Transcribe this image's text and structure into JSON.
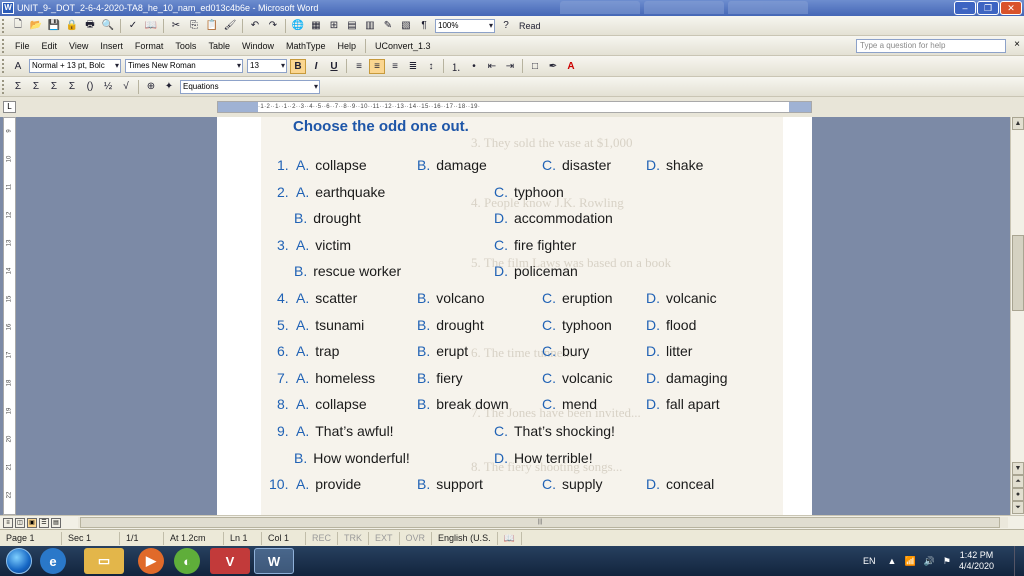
{
  "window": {
    "title": "UNIT_9-_DOT_2-6-4-2020-TA8_he_10_nam_ed013c4b6e - Microsoft Word",
    "minimize": "–",
    "maximize": "❐",
    "close": "✕"
  },
  "toolbar1": {
    "zoom": "100%",
    "read_label": "Read"
  },
  "menu": {
    "items": [
      "File",
      "Edit",
      "View",
      "Insert",
      "Format",
      "Tools",
      "Table",
      "Window",
      "MathType",
      "Help",
      "UConvert_1.3"
    ],
    "help_placeholder": "Type a question for help",
    "close_doc": "×"
  },
  "formatting": {
    "style": "Normal + 13 pt, Bolc",
    "font": "Times New Roman",
    "size": "13",
    "bold": "B",
    "italic": "I",
    "underline": "U"
  },
  "equation_bar": {
    "equations_label": "Equations"
  },
  "ruler": {
    "marks": "·1·2··1··1··2··3··4··5··6··7··8··9··10··11··12··13··14··15··16··17··18··19·",
    "vmarks": [
      "9",
      "10",
      "11",
      "12",
      "13",
      "14",
      "15",
      "16",
      "17",
      "18",
      "19",
      "20",
      "21",
      "22"
    ]
  },
  "document": {
    "heading": "Choose the odd one out.",
    "ghost_text": [
      "3. They sold the vase at $1,000",
      "4. People know J.K. Rowling",
      "5. The film Laws was based on a book",
      "6. The time tunnel...",
      "7. The Jones have been invited...",
      "8. The fiery shooting songs..."
    ],
    "questions": [
      {
        "rows": [
          {
            "num": "1.",
            "opts": [
              {
                "l": "A.",
                "t": "collapse"
              },
              {
                "l": "B.",
                "t": "damage"
              },
              {
                "l": "C.",
                "t": "disaster"
              },
              {
                "l": "D.",
                "t": "shake"
              }
            ]
          }
        ]
      },
      {
        "rows": [
          {
            "num": "2.",
            "opts": [
              {
                "l": "A.",
                "t": "earthquake"
              },
              {
                "l": "C.",
                "t": "typhoon"
              }
            ]
          },
          {
            "num": "",
            "opts": [
              {
                "l": "B.",
                "t": "drought"
              },
              {
                "l": "D.",
                "t": "accommodation"
              }
            ]
          }
        ]
      },
      {
        "rows": [
          {
            "num": "3.",
            "opts": [
              {
                "l": "A.",
                "t": "victim"
              },
              {
                "l": "C.",
                "t": "fire fighter"
              }
            ]
          },
          {
            "num": "",
            "opts": [
              {
                "l": "B.",
                "t": "rescue worker"
              },
              {
                "l": "D.",
                "t": "policeman"
              }
            ]
          }
        ]
      },
      {
        "rows": [
          {
            "num": "4.",
            "opts": [
              {
                "l": "A.",
                "t": "scatter"
              },
              {
                "l": "B.",
                "t": "volcano"
              },
              {
                "l": "C.",
                "t": "eruption"
              },
              {
                "l": "D.",
                "t": "volcanic"
              }
            ]
          }
        ]
      },
      {
        "rows": [
          {
            "num": "5.",
            "opts": [
              {
                "l": "A.",
                "t": "tsunami"
              },
              {
                "l": "B.",
                "t": "drought"
              },
              {
                "l": "C.",
                "t": "typhoon"
              },
              {
                "l": "D.",
                "t": "flood"
              }
            ]
          }
        ]
      },
      {
        "rows": [
          {
            "num": "6.",
            "opts": [
              {
                "l": "A.",
                "t": "trap"
              },
              {
                "l": "B.",
                "t": "erupt"
              },
              {
                "l": "C.",
                "t": "bury"
              },
              {
                "l": "D.",
                "t": "litter"
              }
            ]
          }
        ]
      },
      {
        "rows": [
          {
            "num": "7.",
            "opts": [
              {
                "l": "A.",
                "t": "homeless"
              },
              {
                "l": "B.",
                "t": "fiery"
              },
              {
                "l": "C.",
                "t": "volcanic"
              },
              {
                "l": "D.",
                "t": "damaging"
              }
            ]
          }
        ]
      },
      {
        "rows": [
          {
            "num": "8.",
            "opts": [
              {
                "l": "A.",
                "t": "collapse"
              },
              {
                "l": "B.",
                "t": "break down"
              },
              {
                "l": "C.",
                "t": "mend"
              },
              {
                "l": "D.",
                "t": "fall apart"
              }
            ]
          }
        ]
      },
      {
        "rows": [
          {
            "num": "9.",
            "opts": [
              {
                "l": "A.",
                "t": "That’s awful!"
              },
              {
                "l": "C.",
                "t": "That’s shocking!"
              }
            ]
          },
          {
            "num": "",
            "opts": [
              {
                "l": "B.",
                "t": "How wonderful!"
              },
              {
                "l": "D.",
                "t": "How terrible!"
              }
            ]
          }
        ]
      },
      {
        "rows": [
          {
            "num": "10.",
            "opts": [
              {
                "l": "A.",
                "t": "provide"
              },
              {
                "l": "B.",
                "t": "support"
              },
              {
                "l": "C.",
                "t": "supply"
              },
              {
                "l": "D.",
                "t": "conceal"
              }
            ]
          }
        ]
      }
    ]
  },
  "status": {
    "page": "Page 1",
    "sec": "Sec 1",
    "pages": "1/1",
    "at": "At 1.2cm",
    "ln": "Ln 1",
    "col": "Col 1",
    "rec": "REC",
    "trk": "TRK",
    "ext": "EXT",
    "ovr": "OVR",
    "lang": "English (U.S."
  },
  "taskbar": {
    "lang": "EN",
    "time": "1:42 PM",
    "date": "4/4/2020",
    "word_label": "W",
    "unikey_label": "V"
  }
}
